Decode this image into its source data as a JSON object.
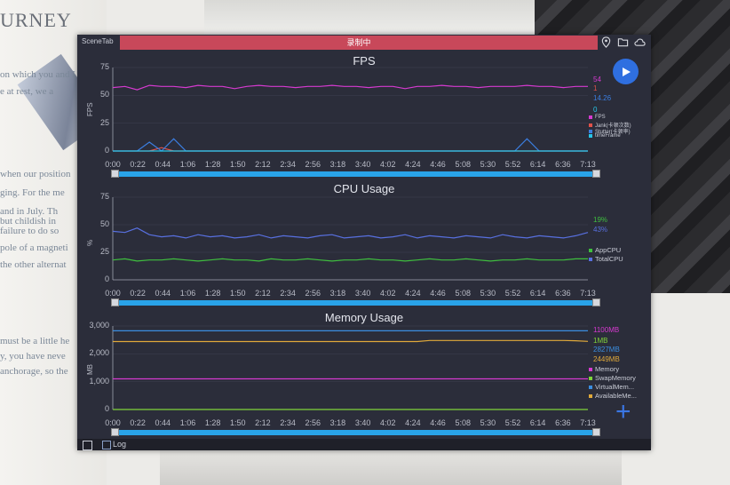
{
  "background": {
    "heading": "URNEY",
    "text_lines": [
      "on which you and I a",
      "e at rest, we a",
      "when our position",
      "ging. For the me",
      "and in July. Th",
      "but childish in",
      "failure to do so",
      "pole of a magneti",
      "the other alternat",
      "must be a little he",
      "y, you have neve",
      "anchorage, so the"
    ]
  },
  "app": {
    "title": "SceneTab",
    "recording_banner": "录制中",
    "play_label": "play",
    "log_label": "Log"
  },
  "x_ticks": [
    "0:00",
    "0:22",
    "0:44",
    "1:06",
    "1:28",
    "1:50",
    "2:12",
    "2:34",
    "2:56",
    "3:18",
    "3:40",
    "4:02",
    "4:24",
    "4:46",
    "5:08",
    "5:30",
    "5:52",
    "6:14",
    "6:36",
    "7:13"
  ],
  "icons": {
    "location": "location-icon",
    "folder": "folder-icon",
    "cloud": "cloud-icon",
    "play": "play-icon",
    "plus": "plus-icon"
  },
  "colors": {
    "fps": "#d63ad0",
    "jank": "#e0524a",
    "stutter": "#3b7ee0",
    "frametime": "#27c6e8",
    "app_cpu": "#3fbf3f",
    "total_cpu": "#5870e0",
    "memory": "#d63ad0",
    "swap": "#7fd43a",
    "virtual": "#3b8ee0",
    "available": "#e0a93a",
    "scrub": "#29a3e8"
  },
  "chart_data": [
    {
      "type": "line",
      "title": "FPS",
      "ylabel": "FPS",
      "ylim": [
        0,
        75
      ],
      "yticks": [
        "75",
        "50",
        "25",
        "0"
      ],
      "current_values": [
        "54",
        "1",
        "14.26",
        "0"
      ],
      "series": [
        {
          "name": "FPS",
          "values": [
            57,
            58,
            55,
            59,
            58,
            58,
            57,
            59,
            58,
            58,
            56,
            58,
            59,
            58,
            58,
            57,
            58,
            58,
            59,
            58,
            58,
            57,
            58,
            58,
            56,
            58,
            58,
            59,
            58,
            58,
            57,
            58,
            58,
            58,
            59,
            58,
            58,
            57,
            58,
            58
          ]
        },
        {
          "name": "Jank(卡顿次数)",
          "values": [
            0,
            0,
            0,
            0,
            3,
            0,
            0,
            0,
            0,
            0,
            0,
            0,
            0,
            0,
            0,
            0,
            0,
            0,
            0,
            0,
            0,
            0,
            0,
            0,
            0,
            0,
            0,
            0,
            0,
            0,
            0,
            0,
            0,
            0,
            0,
            0,
            0,
            0,
            0,
            0
          ]
        },
        {
          "name": "Stutter(卡顿率)",
          "values": [
            0,
            0,
            0,
            8,
            0,
            11,
            0,
            0,
            0,
            0,
            0,
            0,
            0,
            0,
            0,
            0,
            0,
            0,
            0,
            0,
            0,
            0,
            0,
            0,
            0,
            0,
            0,
            0,
            0,
            0,
            0,
            0,
            0,
            0,
            11,
            0,
            0,
            0,
            0,
            0
          ]
        },
        {
          "name": "timeFrame",
          "values": [
            0,
            0,
            0,
            0,
            0,
            0,
            0,
            0,
            0,
            0,
            0,
            0,
            0,
            0,
            0,
            0,
            0,
            0,
            0,
            0,
            0,
            0,
            0,
            0,
            0,
            0,
            0,
            0,
            0,
            0,
            0,
            0,
            0,
            0,
            0,
            0,
            0,
            0,
            0,
            0
          ]
        }
      ]
    },
    {
      "type": "line",
      "title": "CPU Usage",
      "ylabel": "%",
      "ylim": [
        0,
        75
      ],
      "yticks": [
        "75",
        "50",
        "25",
        "0"
      ],
      "current_values": [
        "19%",
        "43%"
      ],
      "series": [
        {
          "name": "AppCPU",
          "values": [
            18,
            19,
            17,
            18,
            18,
            19,
            18,
            17,
            18,
            19,
            18,
            18,
            17,
            19,
            18,
            18,
            19,
            18,
            17,
            18,
            18,
            19,
            18,
            18,
            17,
            18,
            19,
            18,
            18,
            19,
            18,
            17,
            18,
            18,
            19,
            18,
            18,
            18,
            19,
            19
          ]
        },
        {
          "name": "TotalCPU",
          "values": [
            44,
            43,
            47,
            41,
            39,
            40,
            38,
            41,
            39,
            40,
            38,
            39,
            41,
            38,
            40,
            39,
            38,
            40,
            41,
            38,
            39,
            40,
            38,
            39,
            41,
            38,
            40,
            39,
            38,
            40,
            39,
            38,
            41,
            39,
            38,
            40,
            39,
            38,
            40,
            43
          ]
        }
      ]
    },
    {
      "type": "line",
      "title": "Memory Usage",
      "ylabel": "MB",
      "ylim": [
        0,
        3000
      ],
      "yticks": [
        "3,000",
        "2,000",
        "1,000",
        "0"
      ],
      "current_values": [
        "1100MB",
        "1MB",
        "2827MB",
        "2449MB"
      ],
      "series": [
        {
          "name": "Memory",
          "values": [
            1100,
            1100,
            1100,
            1100,
            1100,
            1100,
            1100,
            1100,
            1100,
            1100,
            1100,
            1100,
            1100,
            1100,
            1100,
            1100,
            1100,
            1100,
            1100,
            1100,
            1100,
            1100,
            1100,
            1100,
            1100,
            1100,
            1100,
            1100,
            1100,
            1100,
            1100,
            1100,
            1100,
            1100,
            1100,
            1100,
            1100,
            1100,
            1100,
            1100
          ]
        },
        {
          "name": "SwapMemory",
          "values": [
            1,
            1,
            1,
            1,
            1,
            1,
            1,
            1,
            1,
            1,
            1,
            1,
            1,
            1,
            1,
            1,
            1,
            1,
            1,
            1,
            1,
            1,
            1,
            1,
            1,
            1,
            1,
            1,
            1,
            1,
            1,
            1,
            1,
            1,
            1,
            1,
            1,
            1,
            1,
            1
          ]
        },
        {
          "name": "VirtualMem...",
          "values": [
            2827,
            2827,
            2827,
            2827,
            2827,
            2827,
            2827,
            2827,
            2827,
            2827,
            2827,
            2827,
            2827,
            2827,
            2827,
            2827,
            2827,
            2827,
            2827,
            2827,
            2827,
            2827,
            2827,
            2827,
            2827,
            2827,
            2827,
            2827,
            2827,
            2827,
            2827,
            2827,
            2827,
            2827,
            2827,
            2827,
            2827,
            2827,
            2827,
            2827
          ]
        },
        {
          "name": "AvailableMe...",
          "values": [
            2440,
            2440,
            2440,
            2440,
            2440,
            2440,
            2440,
            2440,
            2440,
            2440,
            2440,
            2440,
            2440,
            2440,
            2440,
            2440,
            2440,
            2440,
            2440,
            2440,
            2440,
            2440,
            2440,
            2440,
            2440,
            2440,
            2480,
            2480,
            2480,
            2480,
            2480,
            2480,
            2480,
            2480,
            2480,
            2480,
            2480,
            2480,
            2470,
            2449
          ]
        }
      ]
    }
  ]
}
